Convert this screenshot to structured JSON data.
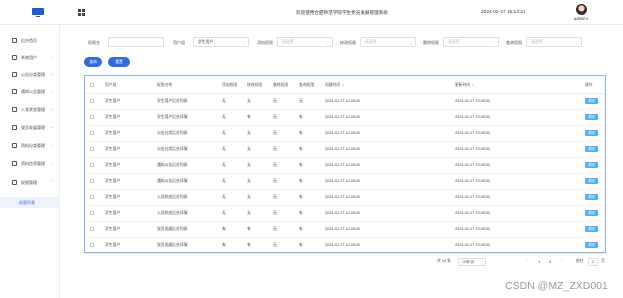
{
  "header": {
    "title": "欢迎使用合肥师范学院学生党员发展管理系统",
    "datetime": "2024-02-27 15:13:21",
    "username": "admin",
    "caret": "▾"
  },
  "sidebar": {
    "items": [
      {
        "label": "后台首页",
        "icon": "home-icon",
        "arrow": ""
      },
      {
        "label": "系统用户",
        "icon": "user-icon",
        "arrow": "⌄"
      },
      {
        "label": "公告分类管理",
        "icon": "category-icon",
        "arrow": "⌄"
      },
      {
        "label": "通知公告管理",
        "icon": "notice-icon",
        "arrow": "⌄"
      },
      {
        "label": "入党状态管理",
        "icon": "status-icon",
        "arrow": "⌄"
      },
      {
        "label": "党员发展管理",
        "icon": "develop-icon",
        "arrow": "⌄"
      },
      {
        "label": "资料分类管理",
        "icon": "folder-icon",
        "arrow": "⌄"
      },
      {
        "label": "资料信息管理",
        "icon": "file-icon",
        "arrow": "⌄"
      },
      {
        "label": "权限管理",
        "icon": "lock-icon",
        "arrow": "⌃"
      }
    ],
    "submenu": {
      "label": "权限列表"
    }
  },
  "search": {
    "fields": [
      {
        "label": "权限名",
        "placeholder": "",
        "value": ""
      },
      {
        "label": "用户组",
        "placeholder": "",
        "value": "学生用户"
      },
      {
        "label": "添加权限",
        "placeholder": "请选择",
        "value": ""
      },
      {
        "label": "修改权限",
        "placeholder": "请选择",
        "value": ""
      },
      {
        "label": "删除权限",
        "placeholder": "请选择",
        "value": ""
      },
      {
        "label": "查询权限",
        "placeholder": "请选择",
        "value": ""
      }
    ],
    "query_label": "查询",
    "reset_label": "重置"
  },
  "table": {
    "columns": [
      "用户组",
      "权限名称",
      "添加权限",
      "修改权限",
      "删除权限",
      "查询权限",
      "创建时间",
      "更新时间",
      "操作"
    ],
    "edit_label": "修改",
    "rows": [
      [
        "学生用户",
        "学生用户后台列表",
        "无",
        "无",
        "无",
        "无",
        "2024-02-27 10:05:30",
        "2024-02-27 10:05:30"
      ],
      [
        "学生用户",
        "学生用户后台详情",
        "无",
        "有",
        "无",
        "有",
        "2024-02-27 10:05:30",
        "2024-02-27 10:05:30"
      ],
      [
        "学生用户",
        "公告分类后台列表",
        "无",
        "无",
        "无",
        "有",
        "2024-02-27 10:05:30",
        "2024-02-27 10:05:30"
      ],
      [
        "学生用户",
        "公告分类后台详情",
        "无",
        "无",
        "无",
        "有",
        "2024-02-27 10:05:30",
        "2024-02-27 10:05:30"
      ],
      [
        "学生用户",
        "通知公告后台列表",
        "无",
        "无",
        "无",
        "有",
        "2024-02-27 10:05:30",
        "2024-02-27 10:05:30"
      ],
      [
        "学生用户",
        "通知公告后台详情",
        "无",
        "无",
        "无",
        "有",
        "2024-02-27 10:05:30",
        "2024-02-27 10:05:30"
      ],
      [
        "学生用户",
        "入党状态后台列表",
        "无",
        "无",
        "无",
        "有",
        "2024-02-27 10:05:30",
        "2024-02-27 10:05:30"
      ],
      [
        "学生用户",
        "入党状态后台详情",
        "无",
        "无",
        "无",
        "有",
        "2024-02-27 10:05:30",
        "2024-02-27 10:05:30"
      ],
      [
        "学生用户",
        "党员发展后台列表",
        "有",
        "有",
        "无",
        "有",
        "2024-02-27 10:05:30",
        "2024-02-27 10:05:30"
      ],
      [
        "学生用户",
        "党员发展后台详情",
        "有",
        "有",
        "无",
        "有",
        "2024-02-27 10:05:30",
        "2024-02-27 10:05:30"
      ]
    ]
  },
  "pagination": {
    "total": "共 18 条",
    "page_size": "10条/页",
    "prev": "‹",
    "pages": [
      "1",
      "2"
    ],
    "current": "2",
    "next": "›",
    "goto_label": "前往",
    "goto_value": "2",
    "page_suffix": "页"
  },
  "watermark": "CSDN @MZ_ZXD001",
  "colors": {
    "accent": "#2f6be6",
    "edit": "#5ba8f5",
    "table_border": "#7db3ff"
  }
}
